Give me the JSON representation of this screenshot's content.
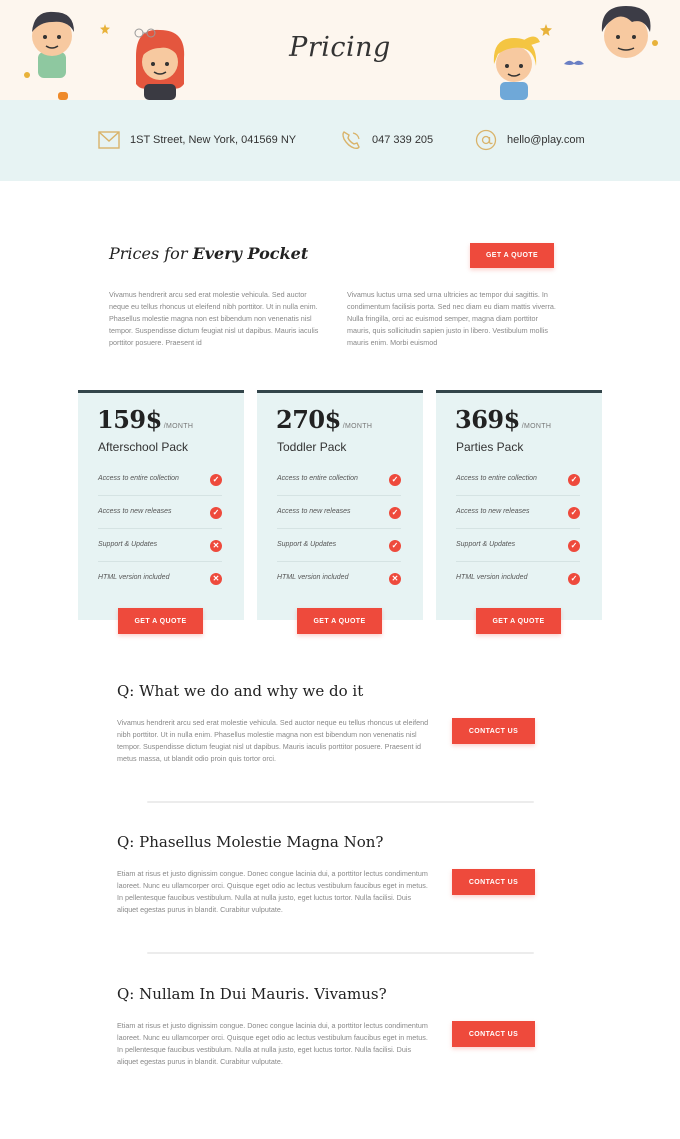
{
  "header": {
    "title": "Pricing",
    "decor_icons": [
      "kid-face-icon",
      "kid-girl-icon",
      "kid-blonde-icon",
      "kid-boy-icon",
      "star-icon",
      "glasses-icon",
      "mustache-icon"
    ]
  },
  "contact": {
    "address": "1ST Street, New York, 041569 NY",
    "phone": "047 339 205",
    "email": "hello@play.com",
    "icons": [
      "mail-icon",
      "phone-icon",
      "at-icon"
    ]
  },
  "intro": {
    "title_light": "Prices for",
    "title_bold": "Every Pocket",
    "quote_button": "GET A QUOTE",
    "col1": "Vivamus hendrerit arcu sed erat molestie vehicula. Sed auctor neque eu tellus rhoncus ut eleifend nibh porttitor. Ut in nulla enim. Phasellus molestie magna non est bibendum non venenatis nisl tempor. Suspendisse dictum feugiat nisl ut dapibus. Mauris iaculis porttitor posuere. Praesent id",
    "col2": "Vivamus luctus urna sed urna ultricies ac tempor dui sagittis. In condimentum facilisis porta. Sed nec diam eu diam mattis viverra. Nulla fringilla, orci ac euismod semper, magna diam porttitor mauris, quis sollicitudin sapien justo in libero. Vestibulum mollis mauris enim. Morbi euismod"
  },
  "plans": [
    {
      "price": "159$",
      "period": "/MONTH",
      "name": "Afterschool Pack",
      "button": "GET A QUOTE",
      "features": [
        {
          "label": "Access to entire collection",
          "included": true
        },
        {
          "label": "Access to new releases",
          "included": true
        },
        {
          "label": "Support & Updates",
          "included": false
        },
        {
          "label": "HTML version included",
          "included": false
        }
      ]
    },
    {
      "price": "270$",
      "period": "/MONTH",
      "name": "Toddler Pack",
      "button": "GET A QUOTE",
      "features": [
        {
          "label": "Access to entire collection",
          "included": true
        },
        {
          "label": "Access to new releases",
          "included": true
        },
        {
          "label": "Support & Updates",
          "included": true
        },
        {
          "label": "HTML version included",
          "included": false
        }
      ]
    },
    {
      "price": "369$",
      "period": "/MONTH",
      "name": "Parties Pack",
      "button": "GET A QUOTE",
      "features": [
        {
          "label": "Access to entire collection",
          "included": true
        },
        {
          "label": "Access to new releases",
          "included": true
        },
        {
          "label": "Support & Updates",
          "included": true
        },
        {
          "label": "HTML version included",
          "included": true
        }
      ]
    }
  ],
  "faq": [
    {
      "question": "Q: What we do and why we do it",
      "answer": "Vivamus hendrerit arcu sed erat molestie vehicula. Sed auctor neque eu tellus rhoncus ut eleifend nibh porttitor. Ut in nulla enim. Phasellus molestie magna non est bibendum non venenatis nisl tempor. Suspendisse dictum feugiat nisl ut dapibus. Mauris iaculis porttitor posuere. Praesent id metus massa, ut blandit odio proin quis tortor orci.",
      "button": "CONTACT US"
    },
    {
      "question": "Q: Phasellus Molestie Magna Non?",
      "answer": "Etiam at risus et justo dignissim congue. Donec congue lacinia dui, a porttitor lectus condimentum laoreet. Nunc eu ullamcorper orci. Quisque eget odio ac lectus vestibulum faucibus eget in metus. In pellentesque faucibus vestibulum. Nulla at nulla justo, eget luctus tortor. Nulla facilisi. Duis aliquet egestas purus in blandit. Curabitur vulputate.",
      "button": "CONTACT US"
    },
    {
      "question": "Q: Nullam In Dui Mauris. Vivamus?",
      "answer": "Etiam at risus et justo dignissim congue. Donec congue lacinia dui, a porttitor lectus condimentum laoreet. Nunc eu ullamcorper orci. Quisque eget odio ac lectus vestibulum faucibus eget in metus. In pellentesque faucibus vestibulum. Nulla at nulla justo, eget luctus tortor. Nulla facilisi. Duis aliquet egestas purus in blandit. Curabitur vulputate.",
      "button": "CONTACT US"
    }
  ],
  "colors": {
    "accent": "#ee4a3c",
    "panel": "#e7f3f3",
    "header_bg": "#fdf6ee",
    "card_top": "#33454a"
  }
}
